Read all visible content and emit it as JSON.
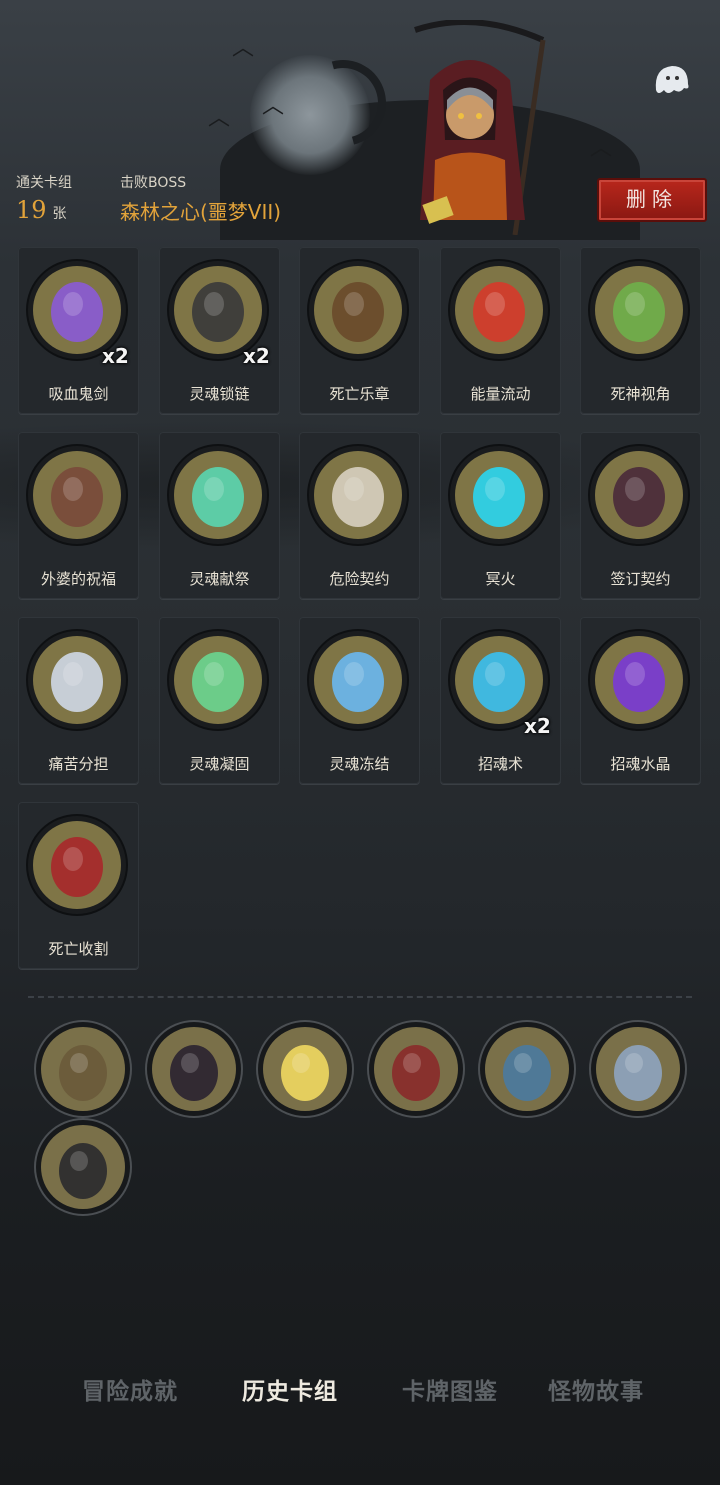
{
  "stats": {
    "cleared_deck_label": "通关卡组",
    "card_count": "19",
    "card_count_unit": "张",
    "boss_label": "击败BOSS",
    "boss_name": "森林之心(噩梦VII)"
  },
  "delete_button": "删除",
  "cards": [
    {
      "name": "吸血鬼剑",
      "count": "x2",
      "icon": "vampire-sword-icon",
      "color": "#8b5bd6"
    },
    {
      "name": "灵魂锁链",
      "count": "x2",
      "icon": "soul-chain-icon",
      "color": "#3a3a3a"
    },
    {
      "name": "死亡乐章",
      "count": "",
      "icon": "death-chest-icon",
      "color": "#6a4a2a"
    },
    {
      "name": "能量流动",
      "count": "",
      "icon": "energy-flow-icon",
      "color": "#d63a2a"
    },
    {
      "name": "死神视角",
      "count": "",
      "icon": "reaper-vision-icon",
      "color": "#6fb04a"
    },
    {
      "name": "外婆的祝福",
      "count": "",
      "icon": "grandma-blessing-icon",
      "color": "#7a4a3a"
    },
    {
      "name": "灵魂献祭",
      "count": "",
      "icon": "soul-sacrifice-icon",
      "color": "#5ad6b0"
    },
    {
      "name": "危险契约",
      "count": "",
      "icon": "danger-contract-icon",
      "color": "#d8d0c0"
    },
    {
      "name": "冥火",
      "count": "",
      "icon": "nether-fire-icon",
      "color": "#2ad6f0"
    },
    {
      "name": "签订契约",
      "count": "",
      "icon": "sign-contract-icon",
      "color": "#4a2a3a"
    },
    {
      "name": "痛苦分担",
      "count": "",
      "icon": "pain-share-icon",
      "color": "#cfd8e6"
    },
    {
      "name": "灵魂凝固",
      "count": "",
      "icon": "soul-solidify-icon",
      "color": "#6ad690"
    },
    {
      "name": "灵魂冻结",
      "count": "",
      "icon": "soul-freeze-icon",
      "color": "#6ab8f0"
    },
    {
      "name": "招魂术",
      "count": "x2",
      "icon": "summon-soul-icon",
      "color": "#3ac0f0"
    },
    {
      "name": "招魂水晶",
      "count": "",
      "icon": "summon-crystal-icon",
      "color": "#7a3ad6"
    },
    {
      "name": "死亡收割",
      "count": "",
      "icon": "death-harvest-icon",
      "color": "#a8282a"
    }
  ],
  "relics": [
    {
      "icon": "old-monk-icon",
      "color": "#6a5a3a"
    },
    {
      "icon": "crow-nest-icon",
      "color": "#2a2230"
    },
    {
      "icon": "glowing-book-icon",
      "color": "#f0d860"
    },
    {
      "icon": "vampire-lord-icon",
      "color": "#8a2a2a"
    },
    {
      "icon": "wizard-icon",
      "color": "#4a7aa0"
    },
    {
      "icon": "dagger-icon",
      "color": "#8ea4c0"
    },
    {
      "icon": "masked-witch-icon",
      "color": "#2a2a2e"
    }
  ],
  "tabs": [
    {
      "label": "冒险成就",
      "active": false
    },
    {
      "label": "历史卡组",
      "active": true
    },
    {
      "label": "卡牌图鉴",
      "active": false
    },
    {
      "label": "怪物故事",
      "active": false
    }
  ]
}
